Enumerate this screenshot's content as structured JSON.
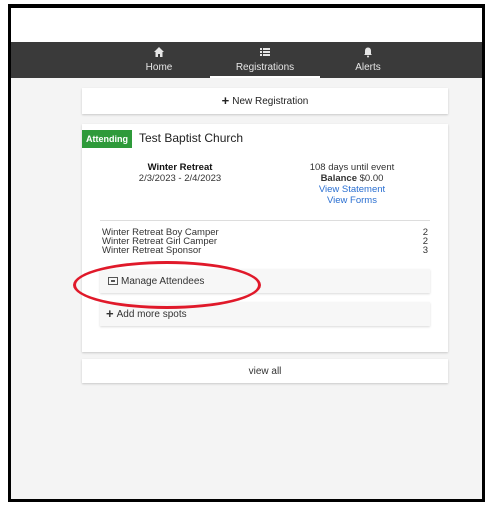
{
  "nav": {
    "items": [
      {
        "label": "Home",
        "icon": "home-icon"
      },
      {
        "label": "Registrations",
        "icon": "list-icon"
      },
      {
        "label": "Alerts",
        "icon": "bell-icon"
      }
    ],
    "active": "Registrations"
  },
  "new_registration": {
    "label": "New Registration"
  },
  "registration": {
    "status_badge": "Attending",
    "church": "Test Baptist Church",
    "event_name": "Winter Retreat",
    "event_dates": "2/3/2023 - 2/4/2023",
    "days_until": "108 days until event",
    "balance_label": "Balance",
    "balance_value": "$0.00",
    "view_statement": "View Statement",
    "view_forms": "View Forms",
    "items": [
      {
        "name": "Winter Retreat Boy Camper",
        "count": "2"
      },
      {
        "name": "Winter Retreat Girl Camper",
        "count": "2"
      },
      {
        "name": "Winter Retreat Sponsor",
        "count": "3"
      }
    ],
    "manage_attendees": "Manage Attendees",
    "add_spots": "Add more spots"
  },
  "view_all": "view all",
  "colors": {
    "nav_bg": "#3a3a3a",
    "badge": "#2e9a3a",
    "link": "#2a6fd1",
    "highlight": "#e0192a"
  }
}
